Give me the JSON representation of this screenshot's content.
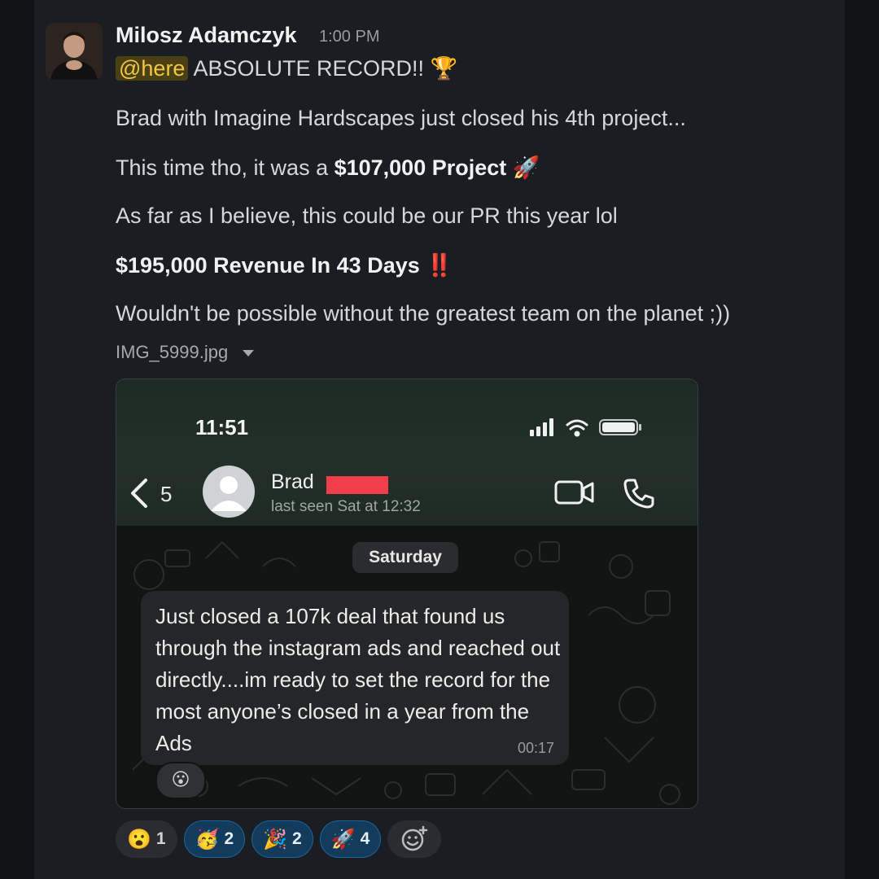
{
  "message": {
    "sender": "Milosz Adamczyk",
    "time": "1:00 PM",
    "mention": "@here",
    "headline": "ABSOLUTE RECORD!!",
    "headline_emoji": "🏆",
    "line1": "Brad with Imagine Hardscapes just closed his 4th project...",
    "line2_prefix": "This time tho, it was a ",
    "line2_bold": "$107,000 Project",
    "line2_emoji": "🚀",
    "line3": "As far as I believe, this could be our PR this year lol",
    "line4_bold": "$195,000 Revenue In 43 Days",
    "line4_emoji": "‼️",
    "line5": "Wouldn't be possible without the greatest team on the planet ;))",
    "attachment_name": "IMG_5999.jpg"
  },
  "screenshot": {
    "status_time": "11:51",
    "back_count": "5",
    "contact_name": "Brad",
    "last_seen": "last seen Sat at 12:32",
    "date_label": "Saturday",
    "bubble_text": "Just closed a 107k deal that found us through the instagram ads and reached out directly....im ready to set the record for the most anyone’s closed in a year from the Ads",
    "bubble_time": "00:17",
    "bubble_reaction": "😮"
  },
  "reactions": [
    {
      "emoji": "😮",
      "count": "1",
      "active": false
    },
    {
      "emoji": "🥳",
      "count": "2",
      "active": true
    },
    {
      "emoji": "🎉",
      "count": "2",
      "active": true
    },
    {
      "emoji": "🚀",
      "count": "4",
      "active": true
    }
  ],
  "icons": {
    "status": [
      "cellular-signal-icon",
      "wifi-icon",
      "battery-icon"
    ],
    "header": [
      "back-chevron-icon",
      "video-call-icon",
      "phone-call-icon"
    ],
    "attachment": "chevron-down-icon",
    "add_reaction": "add-reaction-icon"
  }
}
